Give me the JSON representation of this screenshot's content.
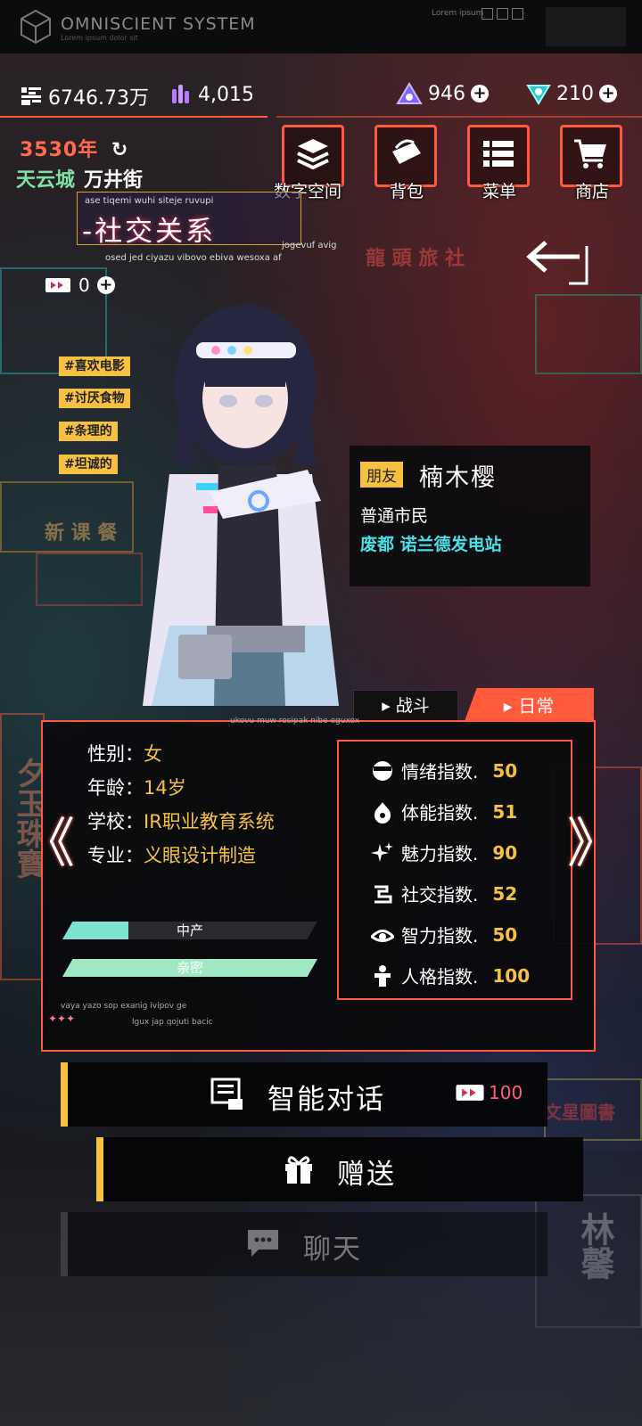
{
  "system": {
    "title": "OMNISCIENT SYSTEM",
    "subtitle": "Lorem ipsum dolor sit",
    "corner_text": "Lorem ipsum"
  },
  "currency": {
    "coins": "6746.73万",
    "gems": "4,015",
    "crystals": "946",
    "shields": "210"
  },
  "time_location": {
    "year": "3530年",
    "city": "天云城",
    "street": "万井街"
  },
  "top_menu": [
    {
      "label": "数字空间",
      "icon": "layers-icon"
    },
    {
      "label": "背包",
      "icon": "bag-icon"
    },
    {
      "label": "菜单",
      "icon": "menu-list-icon"
    },
    {
      "label": "商店",
      "icon": "cart-icon"
    }
  ],
  "page": {
    "title": "-社交关系",
    "deco_top": "ase tiqemi wuhi siteje ruvupi",
    "deco_right": "jogevuf avig",
    "deco_bottom": "osed jed ciyazu vibovo ebiva wesoxa af"
  },
  "pass": {
    "count": "0"
  },
  "tags": [
    "#喜欢电影",
    "#讨厌食物",
    "#条理的",
    "#坦诚的"
  ],
  "friend": {
    "relation": "朋友",
    "name": "楠木樱",
    "role": "普通市民",
    "location": "废都 诺兰德发电站"
  },
  "tabs": {
    "fight": "战斗",
    "daily": "日常"
  },
  "profile": {
    "deco_top": "ukovu muw rosipak nibe eguxox",
    "deco_bottom1": "vaya yazo sop exanig ivipov ge",
    "deco_bottom2": "lgux jap qojuti bacic",
    "fields": [
      {
        "key": "性别：",
        "value": "女"
      },
      {
        "key": "年龄：",
        "value": "14岁"
      },
      {
        "key": "学校：",
        "value": "IR职业教育系统"
      },
      {
        "key": "专业：",
        "value": "义眼设计制造"
      }
    ],
    "bars": [
      {
        "label": "中产",
        "fill": 0.26,
        "color": "#7de3d0"
      },
      {
        "label": "亲密",
        "fill": 1.0,
        "color": "#9fe8c4"
      }
    ]
  },
  "stats": [
    {
      "label": "情绪指数.",
      "value": "50",
      "icon": "mood-icon"
    },
    {
      "label": "体能指数.",
      "value": "51",
      "icon": "fitness-icon"
    },
    {
      "label": "魅力指数.",
      "value": "90",
      "icon": "sparkle-icon"
    },
    {
      "label": "社交指数.",
      "value": "52",
      "icon": "social-icon"
    },
    {
      "label": "智力指数.",
      "value": "50",
      "icon": "eye-icon"
    },
    {
      "label": "人格指数.",
      "value": "100",
      "icon": "person-icon"
    }
  ],
  "nav": {
    "prev": "《",
    "next": "》"
  },
  "actions": {
    "smart_chat": "智能对话",
    "smart_chat_cost": "100",
    "gift": "赠送",
    "chat": "聊天"
  },
  "colors": {
    "accent_red": "#ff5a3c",
    "accent_yellow": "#f6c142",
    "accent_cyan": "#47e0e6",
    "accent_green": "#7de3a4",
    "accent_pink": "#ff5f7a"
  }
}
